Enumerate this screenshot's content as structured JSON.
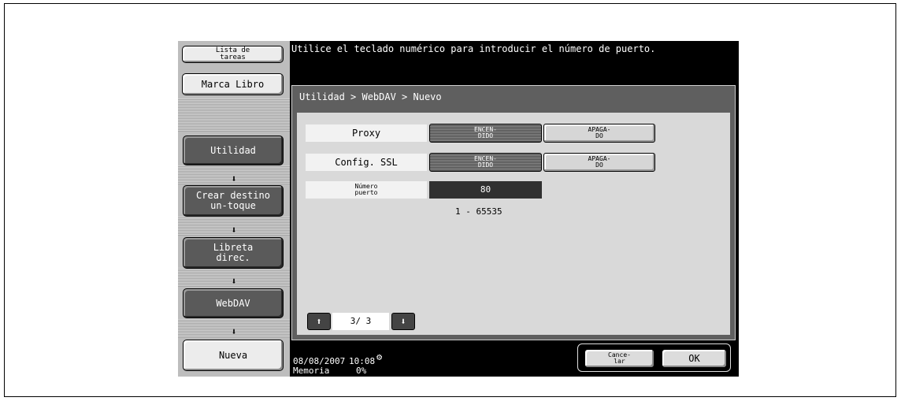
{
  "sidebar": {
    "job_list": "Lista de tareas",
    "bookmark": "Marca Libro",
    "path": [
      {
        "label": "Utilidad"
      },
      {
        "label": "Crear destino un-toque"
      },
      {
        "label": "Libreta direc."
      },
      {
        "label": "WebDAV"
      },
      {
        "label": "Nueva"
      }
    ],
    "arrow_glyph": "⬇"
  },
  "message": "Utilice el teclado numérico para introducir el número de puerto.",
  "breadcrumb": "Utilidad > WebDAV > Nuevo",
  "settings": {
    "proxy": {
      "label": "Proxy",
      "on": "ENCEN-DIDO",
      "off": "APAGA-DO",
      "selected": "on"
    },
    "ssl": {
      "label": "Config. SSL",
      "on": "ENCEN-DIDO",
      "off": "APAGA-DO",
      "selected": "on"
    },
    "port": {
      "label": "Número puerto",
      "value": "80",
      "range": "1 - 65535"
    }
  },
  "pagination": {
    "up": "⬆",
    "indicator": "3/ 3",
    "down": "⬇"
  },
  "status": {
    "date": "08/08/2007",
    "time": "10:08",
    "memory_label": "Memoria",
    "memory_value": "0%"
  },
  "buttons": {
    "cancel": "Cance-lar",
    "ok": "OK"
  }
}
